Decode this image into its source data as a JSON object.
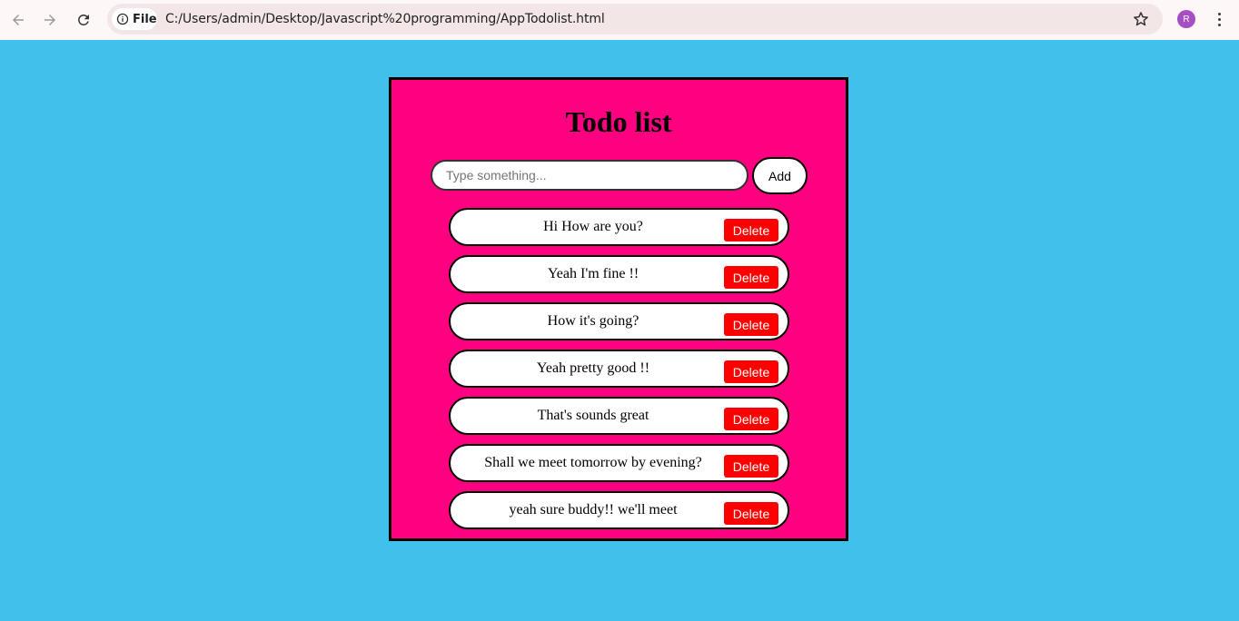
{
  "browser": {
    "file_label": "File",
    "url": "C:/Users/admin/Desktop/Javascript%20programming/AppTodolist.html",
    "profile_initial": "R"
  },
  "app": {
    "title": "Todo list",
    "input_placeholder": "Type something...",
    "input_value": "",
    "add_label": "Add",
    "delete_label": "Delete",
    "items": [
      "Hi How are you?",
      "Yeah I'm fine !!",
      "How it's going?",
      "Yeah pretty good !!",
      "That's sounds great",
      "Shall we meet tomorrow by evening?",
      "yeah sure buddy!! we'll meet"
    ]
  },
  "colors": {
    "page_background": "#40c1eb",
    "card_background": "#ff0080",
    "delete_button": "#ff0000"
  }
}
